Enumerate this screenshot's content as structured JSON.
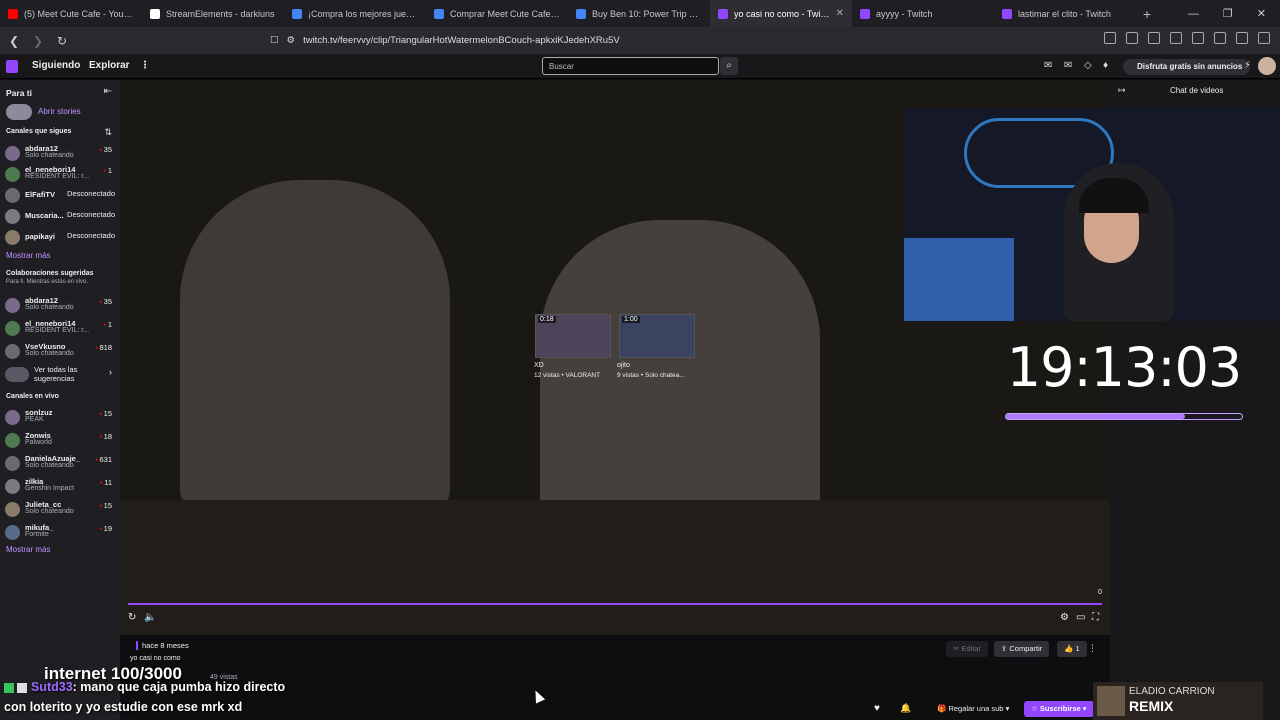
{
  "browser": {
    "tabs": [
      {
        "title": "(5) Meet Cute Cafe - YouTube",
        "color": "#ff0000"
      },
      {
        "title": "StreamElements - darkiuns",
        "color": "#ffffff"
      },
      {
        "title": "¡Compra los mejores juegos m",
        "color": "#4285f4"
      },
      {
        "title": "Comprar Meet Cute Cafe Steam",
        "color": "#4285f4"
      },
      {
        "title": "Buy Ben 10: Power Trip Steam",
        "color": "#4285f4"
      },
      {
        "title": "yo casi no como - Twitch",
        "color": "#9146ff",
        "active": true
      },
      {
        "title": "ayyyy - Twitch",
        "color": "#9146ff"
      },
      {
        "title": "lastimar el clito - Twitch",
        "color": "#9146ff"
      }
    ],
    "url": "twitch.tv/feervvy/clip/TriangularHotWatermelonBCouch-apkxiKJedehXRu5V"
  },
  "nav": {
    "following": "Siguiendo",
    "explore": "Explorar",
    "search_placeholder": "Buscar",
    "promo": "Disfruta gratis sin anuncios"
  },
  "sidebar": {
    "for_you": "Para ti",
    "open_stories": "Abrir stories",
    "followed_header": "Canales que sigues",
    "followed": [
      {
        "name": "abdara12",
        "game": "Solo chateando",
        "count": "35"
      },
      {
        "name": "el_nenebori14",
        "game": "RESIDENT EVIL: r...",
        "count": "1"
      },
      {
        "name": "ElFafiTV",
        "status": "Desconectado"
      },
      {
        "name": "Muscaria...",
        "status": "Desconectado"
      },
      {
        "name": "papikayi",
        "status": "Desconectado"
      }
    ],
    "show_more": "Mostrar más",
    "collab_header": "Colaboraciones sugeridas",
    "collab_sub": "Para ti. Mientras estás en vivo.",
    "collabs": [
      {
        "name": "abdara12",
        "game": "Solo chateando",
        "count": "35"
      },
      {
        "name": "el_nenebori14",
        "game": "RESIDENT EVIL: r...",
        "count": "1"
      },
      {
        "name": "VseVkusno",
        "game": "Solo chateando",
        "count": "818"
      }
    ],
    "see_all": "Ver todas las sugerencias",
    "live_header": "Canales en vivo",
    "live": [
      {
        "name": "sonlzuz",
        "game": "PEAK",
        "count": "15"
      },
      {
        "name": "Zonwis",
        "game": "Palworld",
        "count": "18"
      },
      {
        "name": "DanielaAzuaje_",
        "game": "Solo chateando",
        "count": "631"
      },
      {
        "name": "zilkia",
        "game": "Genshin Impact",
        "count": "11"
      },
      {
        "name": "Julieta_cc",
        "game": "Solo chateando",
        "count": "15"
      },
      {
        "name": "mikufa_",
        "game": "Fortnite",
        "count": "19"
      }
    ],
    "show_more_2": "Mostrar más"
  },
  "player": {
    "recs": [
      {
        "duration": "0:18",
        "title": "XD",
        "sub": "12 vistas • VALORANT"
      },
      {
        "duration": "1:00",
        "title": "ojito",
        "sub": "9 vistas • Solo chatea..."
      }
    ],
    "seek_end": "0"
  },
  "overlay": {
    "clock": "19:13:03",
    "progress": 0.76,
    "internet": "internet  100/3000",
    "chat_user": "Sutd33",
    "chat_line1": ": mano que caja pumba hizo directo",
    "chat_line2": "con loterito y yo estudie con ese mrk xd",
    "remix_line1": "ELADIO CARRION",
    "remix_line2": "REMIX"
  },
  "chat": {
    "header": "Chat de videos"
  },
  "clip": {
    "ago": "hace 8 meses",
    "title": "yo casi no como",
    "views": "49 vistas",
    "edit": "Editar",
    "share": "Compartir",
    "likes": "1",
    "gift": "Regalar una sub",
    "subscribe": "Suscribirse"
  },
  "colors": {
    "accent": "#9146ff",
    "live": "#eb0400"
  }
}
